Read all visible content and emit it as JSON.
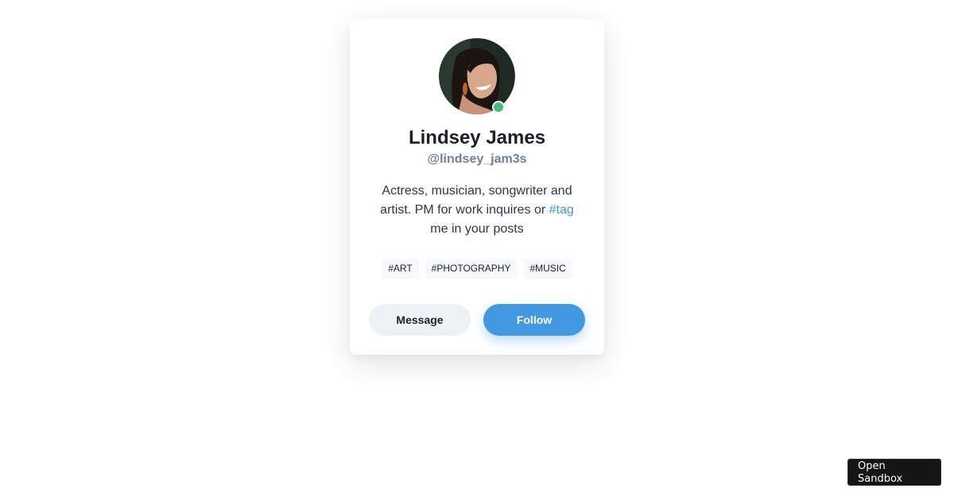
{
  "profile": {
    "avatar_icon": "profile-photo",
    "status": "online",
    "status_color": "#48bb78",
    "name": "Lindsey James",
    "handle": "@lindsey_jam3s",
    "bio_before": "Actress, musician, songwriter and artist. PM for work inquires or ",
    "bio_hashtag": "#tag",
    "bio_after": " me in your posts"
  },
  "tags": [
    "#ART",
    "#PHOTOGRAPHY",
    "#MUSIC"
  ],
  "actions": {
    "message_label": "Message",
    "follow_label": "Follow"
  },
  "colors": {
    "accent": "#4299e1",
    "text_dark": "#1a202c",
    "text_muted": "#718096"
  },
  "sandbox": {
    "label": "Open Sandbox"
  }
}
